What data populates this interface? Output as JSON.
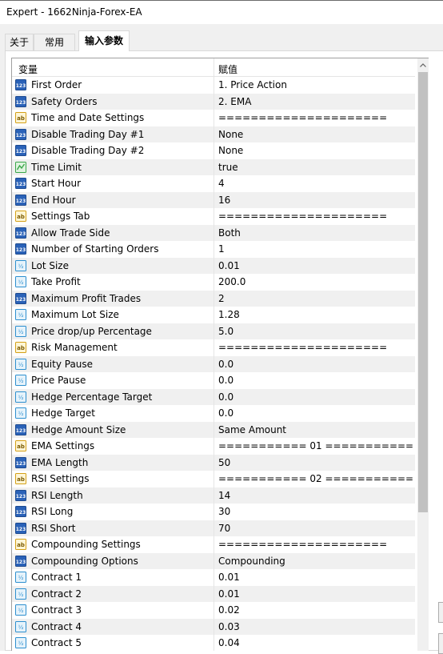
{
  "window": {
    "title": "Expert - 1662Ninja-Forex-EA"
  },
  "tabs": [
    {
      "label": "关于"
    },
    {
      "label": "常用"
    },
    {
      "label": "输入参数"
    }
  ],
  "table": {
    "columns": {
      "variable": "变量",
      "value": "赋值"
    },
    "rows": [
      {
        "name": "First Order",
        "value": "1. Price Action",
        "icon": "int-icon"
      },
      {
        "name": "Safety Orders",
        "value": "2. EMA",
        "icon": "int-icon"
      },
      {
        "name": "Time and Date Settings",
        "value": "=====================",
        "icon": "string-icon"
      },
      {
        "name": "Disable Trading Day #1",
        "value": "None",
        "icon": "int-icon"
      },
      {
        "name": "Disable Trading Day #2",
        "value": "None",
        "icon": "int-icon"
      },
      {
        "name": "Time Limit",
        "value": "true",
        "icon": "bool-icon"
      },
      {
        "name": "Start Hour",
        "value": "4",
        "icon": "int-icon"
      },
      {
        "name": "End Hour",
        "value": "16",
        "icon": "int-icon"
      },
      {
        "name": "Settings Tab",
        "value": "=====================",
        "icon": "string-icon"
      },
      {
        "name": "Allow Trade Side",
        "value": "Both",
        "icon": "int-icon"
      },
      {
        "name": "Number of Starting Orders",
        "value": "1",
        "icon": "int-icon"
      },
      {
        "name": "Lot Size",
        "value": "0.01",
        "icon": "double-icon"
      },
      {
        "name": "Take Profit",
        "value": "200.0",
        "icon": "double-icon"
      },
      {
        "name": "Maximum Profit Trades",
        "value": "2",
        "icon": "int-icon"
      },
      {
        "name": "Maximum Lot Size",
        "value": "1.28",
        "icon": "double-icon"
      },
      {
        "name": "Price drop/up Percentage",
        "value": "5.0",
        "icon": "double-icon"
      },
      {
        "name": "Risk Management",
        "value": "=====================",
        "icon": "string-icon"
      },
      {
        "name": "Equity Pause",
        "value": "0.0",
        "icon": "double-icon"
      },
      {
        "name": "Price Pause",
        "value": "0.0",
        "icon": "double-icon"
      },
      {
        "name": "Hedge Percentage Target",
        "value": "0.0",
        "icon": "double-icon"
      },
      {
        "name": "Hedge Target",
        "value": "0.0",
        "icon": "double-icon"
      },
      {
        "name": "Hedge Amount Size",
        "value": "Same Amount",
        "icon": "int-icon"
      },
      {
        "name": "EMA Settings",
        "value": "=========== 01 ===========",
        "icon": "string-icon"
      },
      {
        "name": "EMA Length",
        "value": "50",
        "icon": "int-icon"
      },
      {
        "name": "RSI Settings",
        "value": "=========== 02 ===========",
        "icon": "string-icon"
      },
      {
        "name": "RSI Length",
        "value": "14",
        "icon": "int-icon"
      },
      {
        "name": "RSI Long",
        "value": "30",
        "icon": "int-icon"
      },
      {
        "name": "RSI Short",
        "value": "70",
        "icon": "int-icon"
      },
      {
        "name": "Compounding Settings",
        "value": "=====================",
        "icon": "string-icon"
      },
      {
        "name": "Compounding Options",
        "value": "Compounding",
        "icon": "int-icon"
      },
      {
        "name": "Contract 1",
        "value": "0.01",
        "icon": "double-icon"
      },
      {
        "name": "Contract 2",
        "value": "0.01",
        "icon": "double-icon"
      },
      {
        "name": "Contract 3",
        "value": "0.02",
        "icon": "double-icon"
      },
      {
        "name": "Contract 4",
        "value": "0.03",
        "icon": "double-icon"
      },
      {
        "name": "Contract 5",
        "value": "0.04",
        "icon": "double-icon"
      }
    ]
  },
  "colors": {
    "row_alt": "#f0f0f0",
    "int_icon": "#2a62b8",
    "double_icon": "#2d8fcf",
    "string_icon": "#d4a017",
    "bool_icon": "#3aa64a"
  }
}
